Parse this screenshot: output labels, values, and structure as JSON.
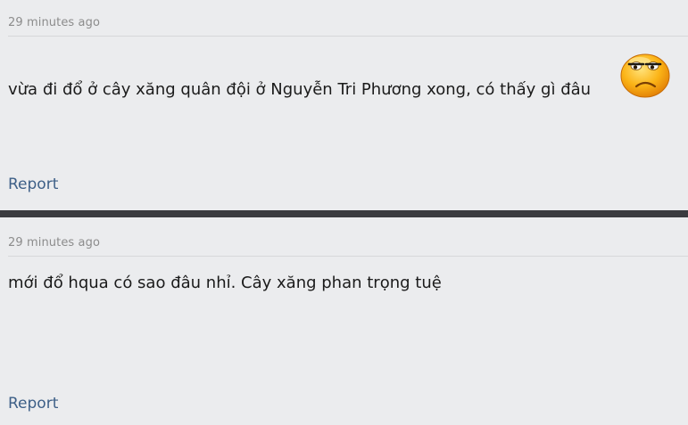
{
  "posts": [
    {
      "timestamp": "29 minutes ago",
      "text": "vừa đi đổ ở cây xăng quân đội ở Nguyễn Tri Phương xong, có thấy gì đâu",
      "emoji_icon": "unamused-face-icon",
      "report_label": "Report"
    },
    {
      "timestamp": "29 minutes ago",
      "text": "mới đổ hqua có sao đâu nhỉ. Cây xăng phan trọng tuệ",
      "report_label": "Report"
    }
  ],
  "colors": {
    "background": "#ebecee",
    "separator": "#3b3c40",
    "link": "#3d5f87",
    "meta_text": "#8c8c8c"
  }
}
